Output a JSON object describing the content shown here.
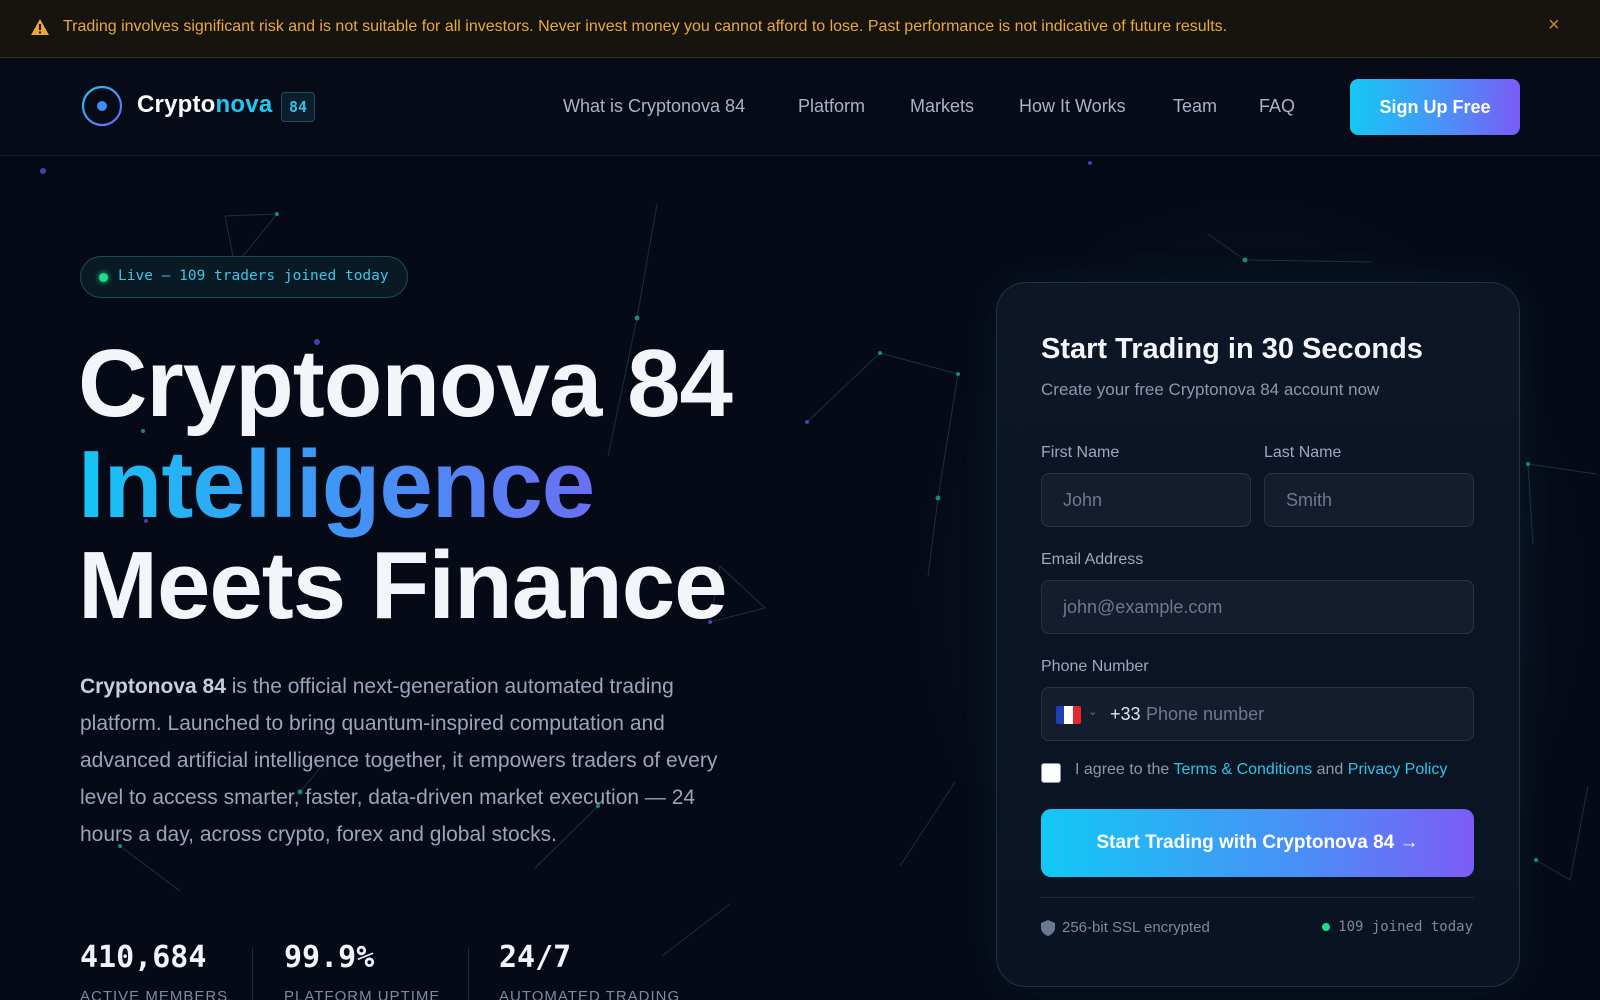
{
  "banner": {
    "text": "Trading involves significant risk and is not suitable for all investors. Never invest money you cannot afford to lose. Past performance is not indicative of future results.",
    "icon": "warning-icon",
    "close_icon": "close-icon",
    "close_label": "×"
  },
  "nav": {
    "logo_main": "Crypto",
    "logo_accent": "nova",
    "logo_badge": "84",
    "links": [
      "What is Cryptonova 84",
      "Platform",
      "Markets",
      "How It Works",
      "Team",
      "FAQ"
    ],
    "signup_label": "Sign Up Free"
  },
  "hero": {
    "live_text": "Live — 109 traders joined today",
    "title_line1": "Cryptonova 84",
    "title_line2": "Intelligence",
    "title_line3": "Meets Finance",
    "desc_brand": "Cryptonova 84",
    "desc_rest": " is the official next-generation automated trading platform. Launched to bring quantum-inspired computation and advanced artificial intelligence together, it empowers traders of every level to access smarter, faster, data-driven market execution — 24 hours a day, across crypto, forex and global stocks."
  },
  "stats": [
    {
      "value": "410,684",
      "label": "ACTIVE MEMBERS"
    },
    {
      "value": "99.9%",
      "label": "PLATFORM UPTIME"
    },
    {
      "value": "24/7",
      "label": "AUTOMATED TRADING"
    }
  ],
  "form": {
    "title": "Start Trading in 30 Seconds",
    "subtitle": "Create your free Cryptonova 84 account now",
    "first_name_label": "First Name",
    "first_name_placeholder": "John",
    "last_name_label": "Last Name",
    "last_name_placeholder": "Smith",
    "email_label": "Email Address",
    "email_placeholder": "john@example.com",
    "phone_label": "Phone Number",
    "dial_code": "+33",
    "phone_placeholder": "Phone number",
    "agree_prefix": "I agree to the ",
    "terms_label": "Terms & Conditions",
    "agree_and": " and ",
    "privacy_label": "Privacy Policy",
    "cta_label": "Start Trading with Cryptonova 84  →",
    "ssl_text": "256-bit SSL encrypted",
    "joined_text": "109 joined today"
  },
  "colors": {
    "background": "#060a16",
    "accent_cyan": "#22c7f0",
    "accent_violet": "#7a5cf6",
    "warning": "#e8a93a",
    "live_green": "#19e08a"
  }
}
